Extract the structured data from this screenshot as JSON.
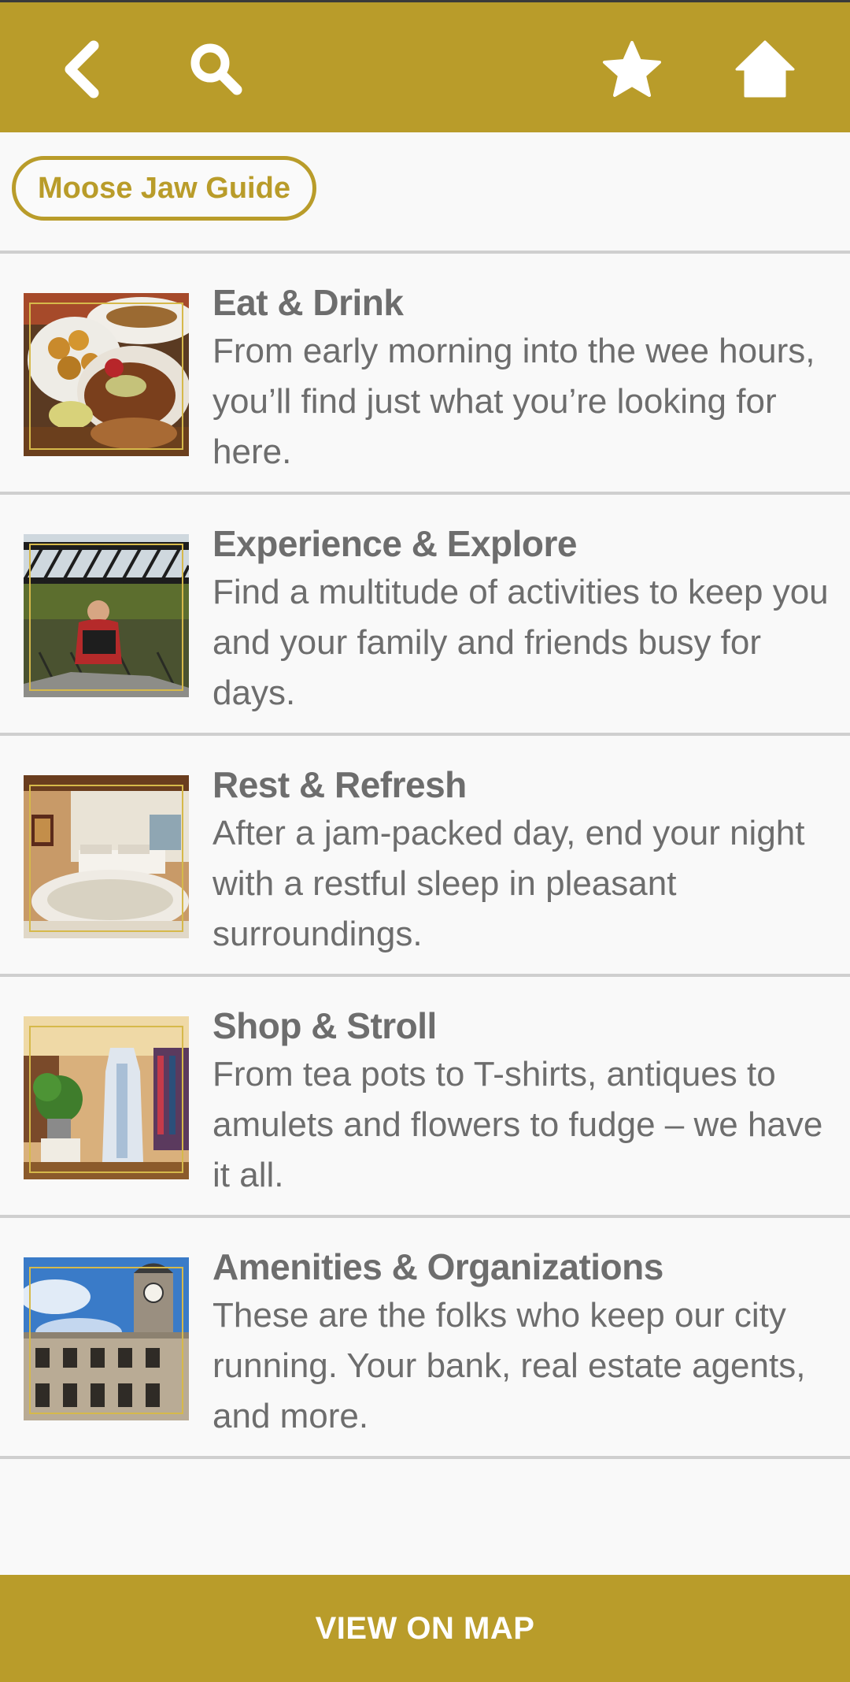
{
  "colors": {
    "accent": "#b99c2a",
    "text": "#6d6d6d",
    "background": "#f9f9f9",
    "divider": "#cfcfcf"
  },
  "header": {
    "icons": [
      "back-icon",
      "search-icon",
      "star-icon",
      "home-icon"
    ]
  },
  "breadcrumb": {
    "label": "Moose Jaw Guide"
  },
  "categories": [
    {
      "title": "Eat & Drink",
      "description": "From early morning into the wee hours, you’ll find just what you’re looking for here.",
      "image": "food-photo"
    },
    {
      "title": "Experience & Explore",
      "description": "Find a multitude of activities to keep you and your family and friends busy for days.",
      "image": "kayak-bridge-photo"
    },
    {
      "title": "Rest & Refresh",
      "description": "After a jam-packed day, end your night with a restful sleep in pleasant surroundings.",
      "image": "hotel-room-photo"
    },
    {
      "title": "Shop & Stroll",
      "description": "From tea pots to T-shirts, antiques to amulets and flowers to fudge – we have it all.",
      "image": "boutique-photo"
    },
    {
      "title": "Amenities & Organizations",
      "description": "These are the folks who keep our city running. Your bank, real estate agents, and more.",
      "image": "city-hall-photo"
    }
  ],
  "footer": {
    "button_label": "VIEW ON MAP"
  }
}
